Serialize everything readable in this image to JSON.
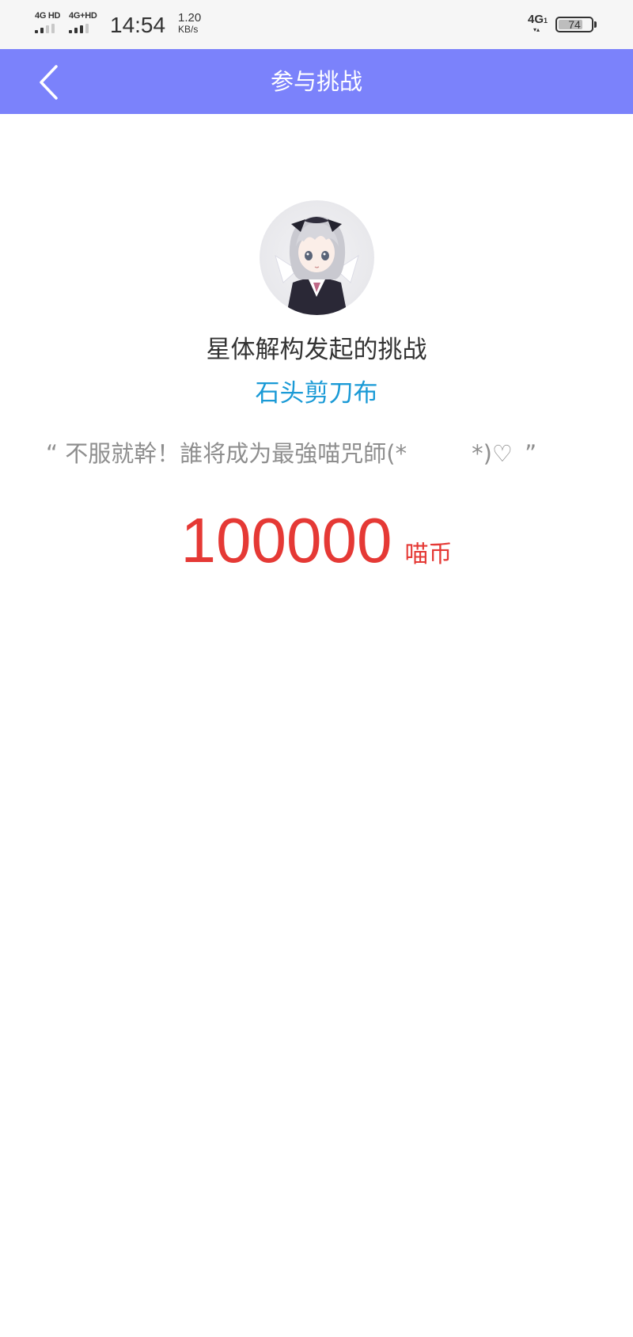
{
  "status_bar": {
    "sim1_label": "4G HD",
    "sim2_label": "4G+HD",
    "time": "14:54",
    "net_speed_value": "1.20",
    "net_speed_unit": "KB/s",
    "network_type": "4G",
    "network_sub": "1",
    "battery_level": "74"
  },
  "nav": {
    "title": "参与挑战",
    "back_icon": "chevron-left-icon"
  },
  "challenge": {
    "avatar_icon": "anime-character-avatar",
    "challenger_line": "星体解构发起的挑战",
    "game_name": "石头剪刀布",
    "slogan_open_quote": "“",
    "slogan_text": "不服就幹！誰将成为最強喵咒師(*",
    "slogan_tail": "*)♡",
    "slogan_close_quote": "”",
    "reward_amount": "100000",
    "reward_unit": "喵币"
  },
  "colors": {
    "nav_bar": "#7b82fb",
    "link_blue": "#1a9ad6",
    "reward_red": "#e53935",
    "slogan_gray": "#8e8e8e",
    "text_dark": "#333333"
  }
}
